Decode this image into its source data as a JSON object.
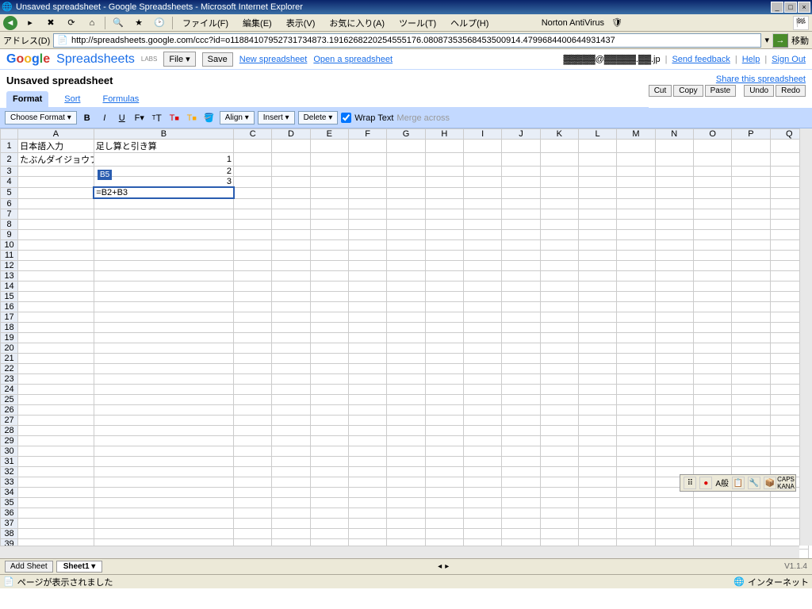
{
  "window": {
    "title": "Unsaved spreadsheet - Google Spreadsheets - Microsoft Internet Explorer"
  },
  "ie_menus": [
    "ファイル(F)",
    "編集(E)",
    "表示(V)",
    "お気に入り(A)",
    "ツール(T)",
    "ヘルプ(H)"
  ],
  "ie_norton": "Norton AntiVirus",
  "addr": {
    "label": "アドレス(D)",
    "url": "http://spreadsheets.google.com/ccc?id=o11884107952731734873.1916268220254555176.08087353568453500914.4799684400644931437",
    "go": "移動"
  },
  "gs": {
    "product": "Spreadsheets",
    "labs": "LABS",
    "file_btn": "File ▾",
    "save_btn": "Save",
    "new_link": "New spreadsheet",
    "open_link": "Open a spreadsheet",
    "email": "▓▓▓▓▓@▓▓▓▓▓.▓▓.jp",
    "feedback": "Send feedback",
    "help": "Help",
    "signout": "Sign Out"
  },
  "doc": {
    "title": "Unsaved spreadsheet",
    "share": "Share this spreadsheet",
    "tabs": [
      "Format",
      "Sort",
      "Formulas"
    ],
    "actions_edit": [
      "Cut",
      "Copy",
      "Paste"
    ],
    "actions_undo": [
      "Undo",
      "Redo"
    ]
  },
  "fmt": {
    "choose": "Choose Format ▾",
    "align": "Align ▾",
    "insert": "Insert ▾",
    "delete": "Delete ▾",
    "wrap": "Wrap Text",
    "merge": "Merge across"
  },
  "columns": [
    "A",
    "B",
    "C",
    "D",
    "E",
    "F",
    "G",
    "H",
    "I",
    "J",
    "K",
    "L",
    "M",
    "N",
    "O",
    "P",
    "Q"
  ],
  "cells": {
    "A1": "日本語入力",
    "B1": "足し算と引き算",
    "A2": "たぶんダイジョウブ",
    "B2": "1",
    "B3": "2",
    "B4": "3",
    "B5": "=B2+B3",
    "tooltip": "B5"
  },
  "sheettabs": {
    "add": "Add Sheet",
    "sheet1": "Sheet1 ▾",
    "version": "V1.1.4"
  },
  "status": {
    "left": "ページが表示されました",
    "zone": "インターネット"
  },
  "ime": [
    "A般"
  ]
}
